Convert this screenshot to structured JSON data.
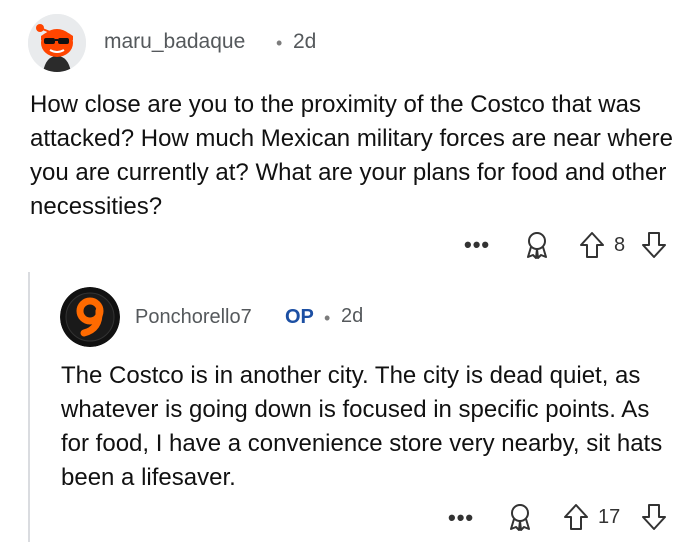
{
  "comment1": {
    "username": "maru_badaque",
    "separator": "•",
    "time": "2d",
    "text": "How close are you to the proximity of the Costco that was attacked? How much Mexican military forces are near where you are currently at? What are your plans for food and other necessities?",
    "more": "•••",
    "votes": "8"
  },
  "comment2": {
    "username": "Ponchorello7",
    "op_badge": "OP",
    "separator": "•",
    "time": "2d",
    "text": "The Costco is in another city. The city is dead quiet, as whatever is going down is focused in specific points. As for food, I have a convenience store very nearby, sit hats been a lifesaver.",
    "more": "•••",
    "votes": "17"
  },
  "icons": [
    "snoo-avatar-icon",
    "number-nine-avatar-icon",
    "more-options-icon",
    "award-icon",
    "upvote-icon",
    "downvote-icon"
  ]
}
